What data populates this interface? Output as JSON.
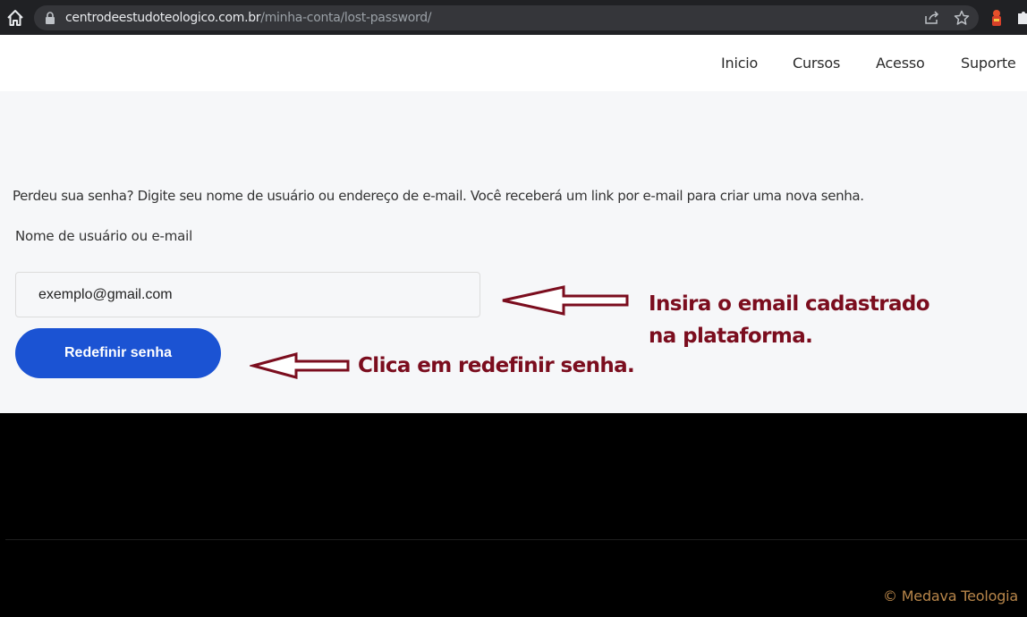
{
  "browser": {
    "url_host": "centrodeestudoteologico.com.br",
    "url_path": "/minha-conta/lost-password/",
    "toolbar_icons": [
      "home-icon",
      "lock-icon",
      "share-icon",
      "star-icon",
      "extension-icon",
      "puzzle-icon"
    ]
  },
  "nav": {
    "items": [
      {
        "label": "Inicio"
      },
      {
        "label": "Cursos"
      },
      {
        "label": "Acesso"
      },
      {
        "label": "Suporte"
      }
    ]
  },
  "form": {
    "intro": "Perdeu sua senha? Digite seu nome de usuário ou endereço de e-mail. Você receberá um link por e-mail para criar uma nova senha.",
    "field_label": "Nome de usuário ou e-mail",
    "email_value": "exemplo@gmail.com",
    "submit_label": "Redefinir senha"
  },
  "annotations": {
    "email_note_line1": "Insira o email cadastrado",
    "email_note_line2": "na plataforma.",
    "button_note": "Clica em redefinir senha."
  },
  "footer": {
    "copyright": "© Medava Teologia"
  },
  "colors": {
    "button": "#1b53d3",
    "annotation": "#7b0d1e",
    "footer_text": "#b8864a",
    "main_bg": "#f6f7f9"
  }
}
